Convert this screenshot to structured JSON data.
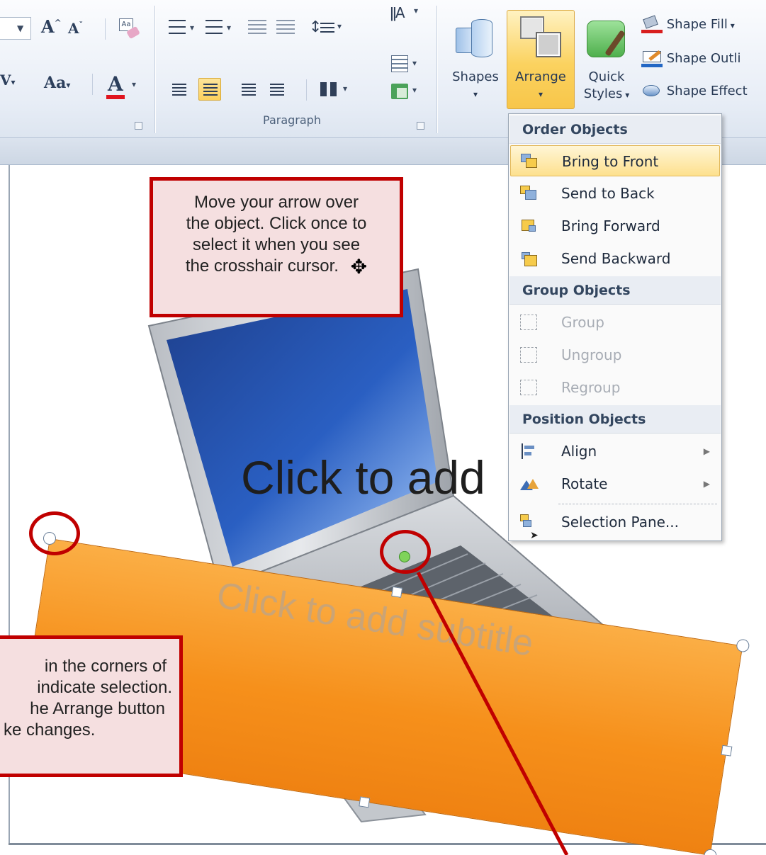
{
  "ribbon": {
    "font_buttons": {
      "grow": "A",
      "shrink": "A",
      "font_case": "Aa",
      "font_color": "A",
      "char_spacing": "V"
    },
    "paragraph_label": "Paragraph",
    "shapes_label": "Shapes",
    "arrange_label": "Arrange",
    "quick_styles_label_1": "Quick",
    "quick_styles_label_2": "Styles",
    "shape_fill": "Shape Fill",
    "shape_outline": "Shape Outli",
    "shape_effects": "Shape Effect"
  },
  "menu": {
    "order_header": "Order Objects",
    "bring_to_front": "Bring to Front",
    "send_to_back": "Send to Back",
    "bring_forward": "Bring Forward",
    "send_backward": "Send Backward",
    "group_header": "Group Objects",
    "group": "Group",
    "ungroup": "Ungroup",
    "regroup": "Regroup",
    "position_header": "Position Objects",
    "align": "Align",
    "rotate": "Rotate",
    "selection_pane": "Selection Pane..."
  },
  "slide": {
    "title_placeholder": "Click to add",
    "subtitle_placeholder": "Click to add subtitle"
  },
  "callouts": {
    "top": [
      "Move your arrow over",
      "the object. Click once to",
      "select it when you see",
      "the crosshair cursor."
    ],
    "bottom": [
      "in the corners of",
      "indicate selection.",
      "he Arrange button",
      "ke changes."
    ]
  },
  "colors": {
    "accent_red": "#c00000",
    "orange": "#f6901b",
    "highlight": "#fbd25f"
  }
}
